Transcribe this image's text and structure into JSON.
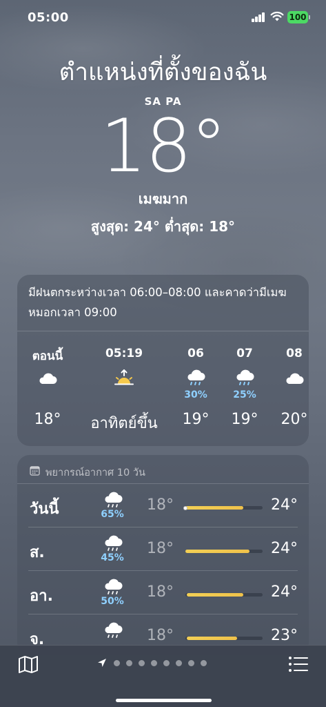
{
  "status": {
    "time": "05:00",
    "battery": "100"
  },
  "location": {
    "title": "ตำแหน่งที่ตั้งของฉัน",
    "place": "SA PA",
    "temperature": "18°",
    "condition": "เมฆมาก",
    "high_low": "สูงสุด: 24°  ต่ำสุด: 18°"
  },
  "hourly": {
    "summary": "มีฝนตกระหว่างเวลา 06:00–08:00 และคาดว่ามีเมฆหมอกเวลา 09:00",
    "items": [
      {
        "label": "ตอนนี้",
        "icon": "cloud-icon",
        "pop": "",
        "temp": "18°"
      },
      {
        "label": "05:19",
        "icon": "sunrise-icon",
        "pop": "",
        "temp": "อาทิตย์ขึ้น"
      },
      {
        "label": "06",
        "icon": "cloud-rain-icon",
        "pop": "30%",
        "temp": "19°"
      },
      {
        "label": "07",
        "icon": "cloud-rain-icon",
        "pop": "25%",
        "temp": "19°"
      },
      {
        "label": "08",
        "icon": "cloud-icon",
        "pop": "",
        "temp": "20°"
      }
    ]
  },
  "daily": {
    "title": "พยากรณ์อากาศ 10 วัน",
    "days": [
      {
        "name": "วันนี้",
        "icon": "cloud-rain-icon",
        "pop": "65%",
        "low": "18°",
        "high": "24°",
        "bar_start": 0.0,
        "bar_end": 0.75,
        "current": 0.0
      },
      {
        "name": "ส.",
        "icon": "cloud-rain-icon",
        "pop": "45%",
        "low": "18°",
        "high": "24°",
        "bar_start": 0.0,
        "bar_end": 0.83
      },
      {
        "name": "อา.",
        "icon": "cloud-rain-icon",
        "pop": "50%",
        "low": "18°",
        "high": "24°",
        "bar_start": 0.02,
        "bar_end": 0.75
      },
      {
        "name": "จ.",
        "icon": "cloud-rain-icon",
        "pop": "",
        "low": "18°",
        "high": "23°",
        "bar_start": 0.02,
        "bar_end": 0.67
      }
    ]
  },
  "colors": {
    "rain": "#8fd0ff",
    "bar": "#f2cf55",
    "battery": "#4cd964"
  }
}
